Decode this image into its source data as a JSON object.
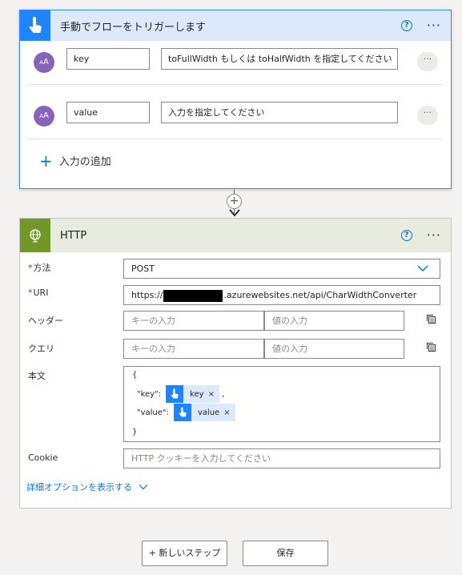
{
  "trigger": {
    "title": "手動でフローをトリガーします",
    "help": "?",
    "more": "···",
    "inputs": [
      {
        "avatar_big": "A",
        "avatar_small": "A",
        "name": "key",
        "description": "toFullWidth もしくは toHalfWidth を指定してください",
        "more": "···"
      },
      {
        "avatar_big": "A",
        "avatar_small": "A",
        "name": "value",
        "description": "入力を指定してください",
        "more": "···"
      }
    ],
    "add_input_icon": "+",
    "add_input_label": "入力の追加"
  },
  "connector": {
    "plus": "+"
  },
  "http": {
    "title": "HTTP",
    "help": "?",
    "more": "···",
    "method_label": "方法",
    "method_required": "*",
    "method_value": "POST",
    "uri_label": "URI",
    "uri_required": "*",
    "uri_prefix": "https://",
    "uri_suffix": ".azurewebsites.net/api/CharWidthConverter",
    "headers_label": "ヘッダー",
    "headers_key_placeholder": "キーの入力",
    "headers_value_placeholder": "値の入力",
    "queries_label": "クエリ",
    "queries_key_placeholder": "キーの入力",
    "queries_value_placeholder": "値の入力",
    "body_label": "本文",
    "body": {
      "open": "{",
      "key_prefix": "\"key\":",
      "key_token": "key",
      "key_suffix": ",",
      "value_prefix": "\"value\":",
      "value_token": "value",
      "close": "}",
      "token_remove": "×"
    },
    "cookie_label": "Cookie",
    "cookie_placeholder": "HTTP クッキーを入力してください",
    "advanced_label": "詳細オプションを表示する"
  },
  "footer": {
    "new_step": "+ 新しいステップ",
    "save": "保存"
  },
  "colors": {
    "trigger_accent": "#1f85ff",
    "http_accent": "#709727",
    "link": "#0078d4"
  }
}
